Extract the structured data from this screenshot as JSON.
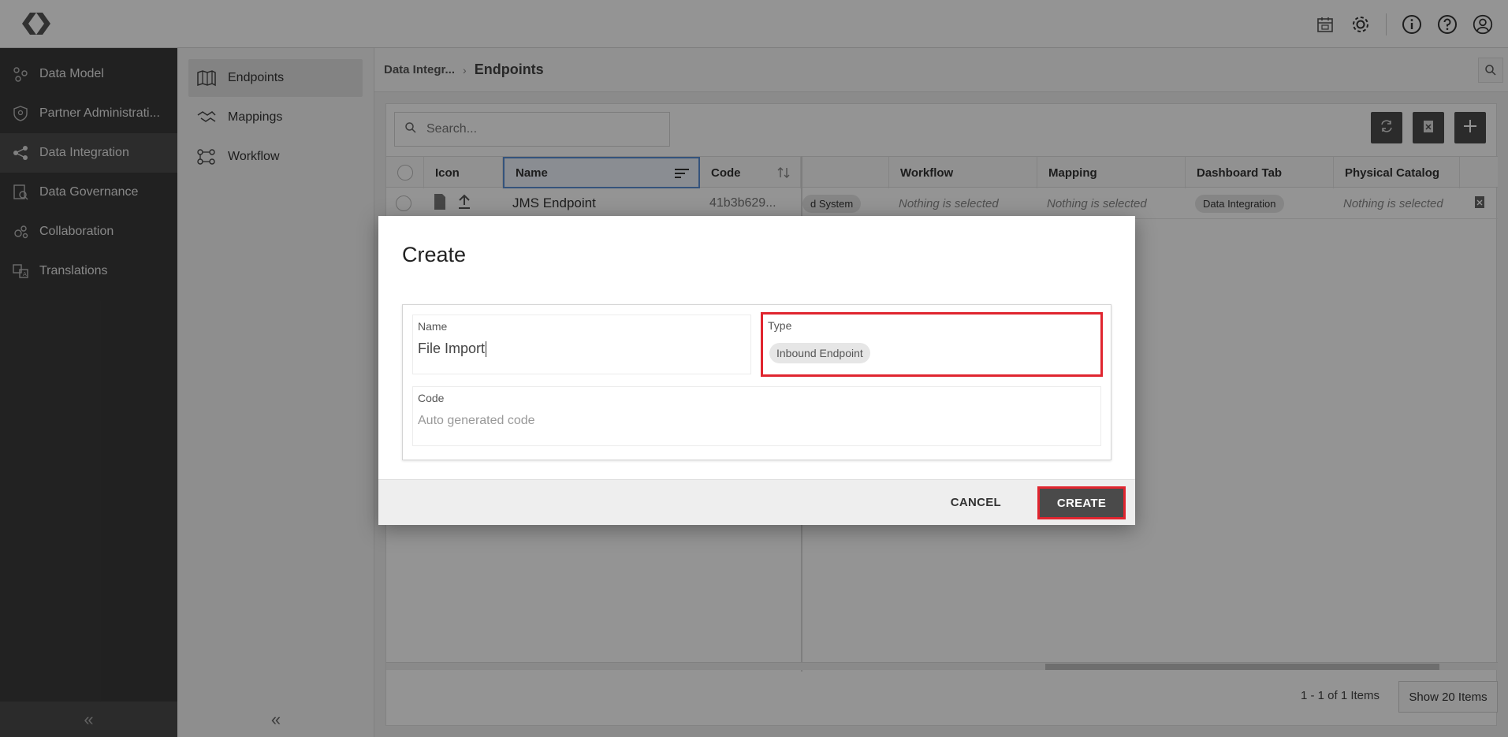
{
  "topbar": {
    "icons": [
      "calendar-icon",
      "gear-icon",
      "info-icon",
      "help-icon",
      "user-icon"
    ]
  },
  "sidebar": {
    "items": [
      {
        "label": "Data Model",
        "icon": "data-model-icon",
        "active": false
      },
      {
        "label": "Partner Administrati...",
        "icon": "shield-icon",
        "active": false
      },
      {
        "label": "Data Integration",
        "icon": "integration-icon",
        "active": true
      },
      {
        "label": "Data Governance",
        "icon": "governance-icon",
        "active": false
      },
      {
        "label": "Collaboration",
        "icon": "collaboration-icon",
        "active": false
      },
      {
        "label": "Translations",
        "icon": "translation-icon",
        "active": false
      }
    ],
    "collapse": "«"
  },
  "subnav": {
    "items": [
      {
        "label": "Endpoints",
        "icon": "map-icon",
        "active": true
      },
      {
        "label": "Mappings",
        "icon": "handshake-icon",
        "active": false
      },
      {
        "label": "Workflow",
        "icon": "workflow-icon",
        "active": false
      }
    ],
    "collapse": "«"
  },
  "breadcrumb": {
    "parent": "Data Integr...",
    "separator": "›",
    "current": "Endpoints"
  },
  "search": {
    "placeholder": "Search..."
  },
  "table": {
    "columns": {
      "icon": "Icon",
      "name": "Name",
      "code": "Code",
      "workflow": "Workflow",
      "mapping": "Mapping",
      "dashboard_tab": "Dashboard Tab",
      "physical_catalog": "Physical Catalog"
    },
    "row": {
      "name": "JMS Endpoint",
      "code": "41b3b629...",
      "system_chip": "d System",
      "workflow": "Nothing is selected",
      "mapping": "Nothing is selected",
      "dashboard_tab": "Data Integration",
      "physical_catalog": "Nothing is selected"
    }
  },
  "pagination": {
    "count": "1 - 1 of 1 Items",
    "show": "Show 20 Items"
  },
  "modal": {
    "title": "Create",
    "name_label": "Name",
    "name_value": "File Import",
    "type_label": "Type",
    "type_value": "Inbound Endpoint",
    "code_label": "Code",
    "code_placeholder": "Auto generated code",
    "cancel": "CANCEL",
    "create": "CREATE"
  },
  "colors": {
    "highlight": "#e0252f",
    "sidebar_bg": "#3a3a3a",
    "button_dark": "#4a4a4a"
  }
}
